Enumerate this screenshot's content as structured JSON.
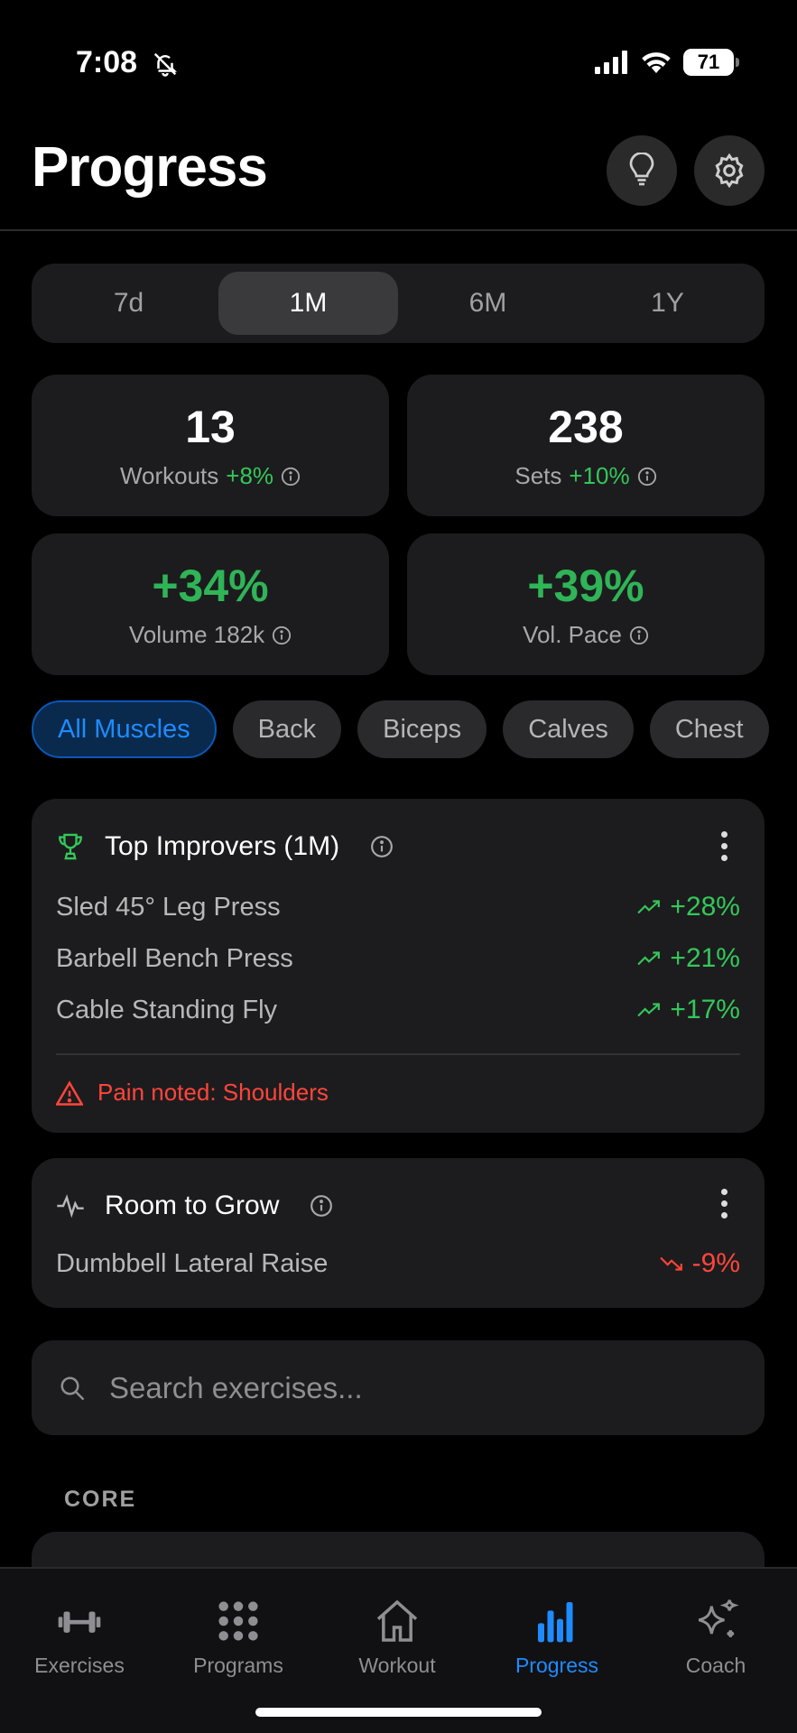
{
  "status_bar": {
    "time": "7:08",
    "battery": "71"
  },
  "header": {
    "title": "Progress",
    "icons": [
      "lightbulb-icon",
      "gear-icon"
    ]
  },
  "range": {
    "options": [
      "7d",
      "1M",
      "6M",
      "1Y"
    ],
    "selected": "1M"
  },
  "stats": [
    {
      "value": "13",
      "label": "Workouts",
      "delta": "+8%"
    },
    {
      "value": "238",
      "label": "Sets",
      "delta": "+10%"
    },
    {
      "value": "+34%",
      "label": "Volume 182k",
      "delta": ""
    },
    {
      "value": "+39%",
      "label": "Vol. Pace",
      "delta": ""
    }
  ],
  "muscles": {
    "items": [
      "All Muscles",
      "Back",
      "Biceps",
      "Calves",
      "Chest"
    ],
    "selected": "All Muscles"
  },
  "top_improvers": {
    "title": "Top Improvers (1M)",
    "items": [
      {
        "name": "Sled 45° Leg Press",
        "change": "+28%"
      },
      {
        "name": "Barbell Bench Press",
        "change": "+21%"
      },
      {
        "name": "Cable Standing Fly",
        "change": "+17%"
      }
    ],
    "warning": "Pain noted: Shoulders"
  },
  "room_to_grow": {
    "title": "Room to Grow",
    "items": [
      {
        "name": "Dumbbell Lateral Raise",
        "change": "-9%"
      }
    ]
  },
  "search": {
    "placeholder": "Search exercises..."
  },
  "section_label": "CORE",
  "tabs": [
    {
      "label": "Exercises",
      "icon": "dumbbell-icon"
    },
    {
      "label": "Programs",
      "icon": "grid-icon"
    },
    {
      "label": "Workout",
      "icon": "home-icon"
    },
    {
      "label": "Progress",
      "icon": "bar-chart-icon",
      "active": true
    },
    {
      "label": "Coach",
      "icon": "sparkles-icon"
    }
  ],
  "colors": {
    "accent": "#1e8bff",
    "positive": "#34c759",
    "negative": "#ff453a",
    "card": "#1c1c1e"
  }
}
